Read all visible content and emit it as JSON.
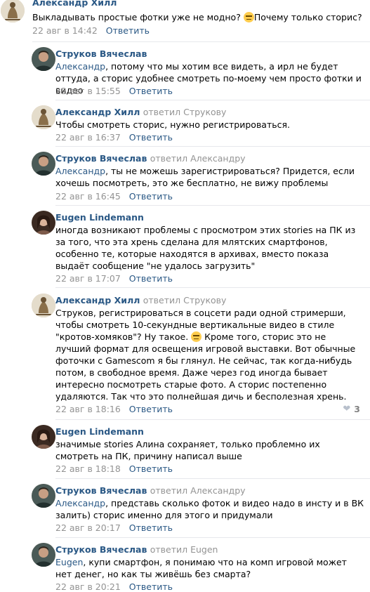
{
  "comments": [
    {
      "author": "Александр Хилл",
      "reply_to": "",
      "text_before": "Выкладывать простые фотки уже не модно?",
      "text_after": "Почему только сторис?",
      "date": "22 авг в 14:42",
      "reply_label": "Ответить"
    },
    {
      "author": "Струков Вячеслав",
      "reply_to": "",
      "mention": "Александр",
      "text": ", потому что мы хотим все видеть, а ирл не будет оттуда, а сторис удобнее смотреть по-моему чем просто фотки и видео",
      "date": "22 авг в 15:55",
      "reply_label": "Ответить"
    },
    {
      "author": "Александр Хилл",
      "reply_prefix": "ответил",
      "reply_to": "Струкову",
      "text": "Чтобы смотреть сторис, нужно регистрироваться.",
      "date": "22 авг в 16:37",
      "reply_label": "Ответить"
    },
    {
      "author": "Струков Вячеслав",
      "reply_prefix": "ответил",
      "reply_to": "Александру",
      "mention": "Александр",
      "text": ", ты не можешь зарегистрироваться? Придется, если хочешь посмотреть, это же бесплатно, не вижу проблемы",
      "date": "22 авг в 16:45",
      "reply_label": "Ответить"
    },
    {
      "author": "Eugen Lindemann",
      "reply_to": "",
      "text": "иногда возникают проблемы с просмотром этих stories на ПК из за того, что эта хрень сделана для млятских смартфонов, особенно те, которые находятся в архивах, вместо показа выдаёт сообщение \"не удалось загрузить\"",
      "date": "22 авг в 17:07",
      "reply_label": "Ответить"
    },
    {
      "author": "Александр Хилл",
      "reply_prefix": "ответил",
      "reply_to": "Струкову",
      "text_before": "Струков, регистрироваться в соцсети ради одной стримерши, чтобы смотреть 10-секундные вертикальные видео в стиле \"кротов-хомяков\"? Ну такое.",
      "text_after": "Кроме того, сторис это не лучший формат для освещения игровой выставки. Вот обычные фоточки с Gamescom я бы глянул. Не сейчас, так когда-нибудь потом, в свободное время. Даже через год иногда бывает интересно посмотреть старые фото. А сторис постепенно удаляются. Так что это полнейшая дичь и бесполезная хрень.",
      "date": "22 авг в 18:16",
      "reply_label": "Ответить",
      "likes": "3"
    },
    {
      "author": "Eugen Lindemann",
      "reply_to": "",
      "text": "значимые stories Алина сохраняет, только проблемно их смотреть на ПК, причину написал выше",
      "date": "22 авг в 18:18",
      "reply_label": "Ответить"
    },
    {
      "author": "Струков Вячеслав",
      "reply_prefix": "ответил",
      "reply_to": "Александру",
      "mention": "Александр",
      "text": ", представь сколько фоток и видео надо в инсту и в ВК залить) сторис именно для этого и придумали",
      "date": "22 авг в 20:17",
      "reply_label": "Ответить"
    },
    {
      "author": "Струков Вячеслав",
      "reply_prefix": "ответил",
      "reply_to": "Eugen",
      "mention": "Eugen",
      "text": ", купи смартфон, я понимаю что на комп игровой может нет денег, но как ты живёшь без смарта?",
      "date": "22 авг в 20:21",
      "reply_label": "Ответить"
    }
  ],
  "colors": {
    "link": "#2a5885",
    "meta": "#939393",
    "separator": "#e7e8ec"
  }
}
